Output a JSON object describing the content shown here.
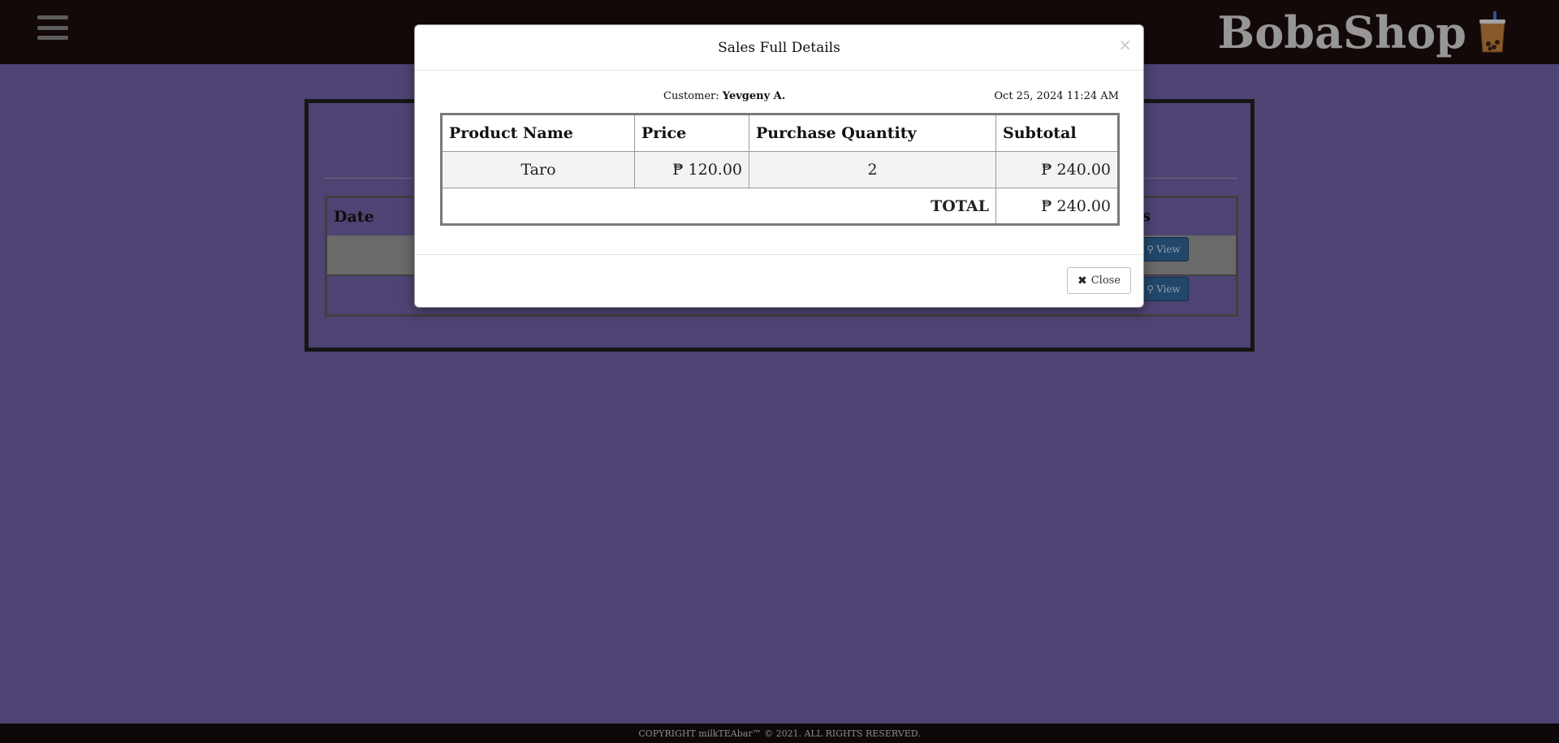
{
  "app": {
    "brand": "BobaShop",
    "icons": {
      "menu": "hamburger-icon",
      "brand_cup": "boba-cup-icon",
      "view": "search-icon",
      "close": "times-icon"
    }
  },
  "colors": {
    "topbar": "#1a0d0d",
    "page_bg": "#6a5a9a",
    "view_button": "#2c5f8f"
  },
  "background_table": {
    "headers": {
      "date": "Date",
      "details": "ils"
    },
    "view_label": "View"
  },
  "modal": {
    "title": "Sales Full Details",
    "close_x": "×",
    "customer_label": "Customer:",
    "customer_name": "Yevgeny A.",
    "datetime": "Oct 25, 2024 11:24 AM",
    "columns": {
      "product": "Product Name",
      "price": "Price",
      "qty": "Purchase Quantity",
      "subtotal": "Subtotal"
    },
    "items": [
      {
        "product": "Taro",
        "price": "₱ 120.00",
        "qty": "2",
        "subtotal": "₱ 240.00"
      }
    ],
    "total_label": "TOTAL",
    "total_value": "₱ 240.00",
    "close_button": "Close"
  },
  "footer": {
    "text": "COPYRIGHT milkTEAbar™ © 2021. ALL RIGHTS RESERVED."
  }
}
